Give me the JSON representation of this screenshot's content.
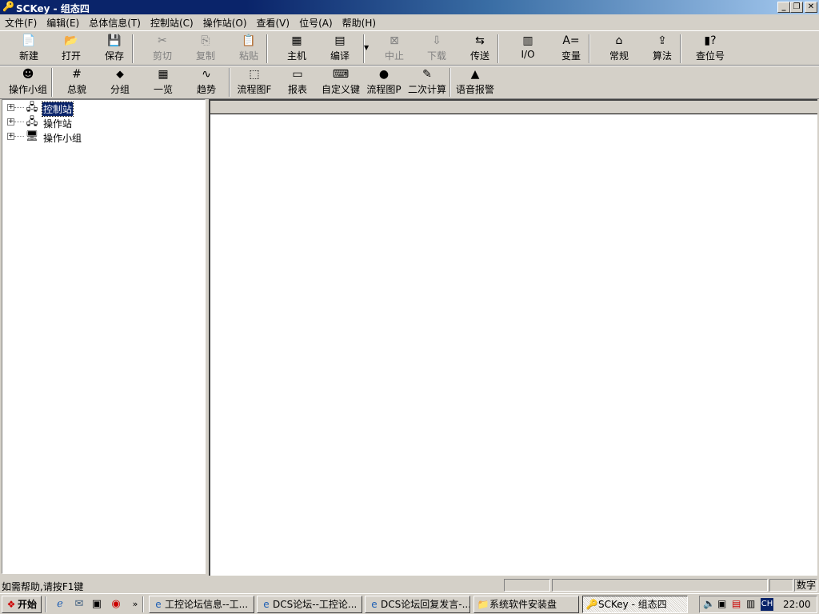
{
  "window": {
    "title": "SCKey - 组态四",
    "min": "_",
    "restore": "❐",
    "close": "✕"
  },
  "menu": [
    "文件(F)",
    "编辑(E)",
    "总体信息(T)",
    "控制站(C)",
    "操作站(O)",
    "查看(V)",
    "位号(A)",
    "帮助(H)"
  ],
  "toolbar1": [
    {
      "label": "新建",
      "icon": "📄",
      "disabled": false
    },
    {
      "label": "打开",
      "icon": "📂",
      "disabled": false
    },
    {
      "label": "保存",
      "icon": "💾",
      "disabled": false
    },
    {
      "label": "剪切",
      "icon": "✂",
      "disabled": true
    },
    {
      "label": "复制",
      "icon": "⎘",
      "disabled": true
    },
    {
      "label": "粘贴",
      "icon": "📋",
      "disabled": true
    },
    {
      "label": "主机",
      "icon": "▦",
      "disabled": false
    },
    {
      "label": "编译",
      "icon": "▤",
      "disabled": false
    },
    {
      "label": "中止",
      "icon": "⊠",
      "disabled": true
    },
    {
      "label": "下载",
      "icon": "⇩",
      "disabled": true
    },
    {
      "label": "传送",
      "icon": "⇆",
      "disabled": false
    },
    {
      "label": "I/O",
      "icon": "▥",
      "disabled": false
    },
    {
      "label": "变量",
      "icon": "A=",
      "disabled": false
    },
    {
      "label": "常规",
      "icon": "⌂",
      "disabled": false
    },
    {
      "label": "算法",
      "icon": "⇪",
      "disabled": false
    },
    {
      "label": "查位号",
      "icon": "▮?",
      "disabled": false
    }
  ],
  "toolbar2": [
    {
      "label": "操作小组",
      "icon": "☻"
    },
    {
      "label": "总貌",
      "icon": "#"
    },
    {
      "label": "分组",
      "icon": "⬥"
    },
    {
      "label": "一览",
      "icon": "▦"
    },
    {
      "label": "趋势",
      "icon": "∿"
    },
    {
      "label": "流程图F",
      "icon": "⬚"
    },
    {
      "label": "报表",
      "icon": "▭"
    },
    {
      "label": "自定义键",
      "icon": "⌨"
    },
    {
      "label": "流程图P",
      "icon": "●"
    },
    {
      "label": "二次计算",
      "icon": "✎"
    },
    {
      "label": "语音报警",
      "icon": "▲"
    }
  ],
  "tree": [
    {
      "label": "控制站",
      "icon": "🖧",
      "selected": true
    },
    {
      "label": "操作站",
      "icon": "🖧",
      "selected": false
    },
    {
      "label": "操作小组",
      "icon": "🖥",
      "selected": false
    }
  ],
  "status": {
    "help": "如需帮助,请按F1键",
    "numlock": "数字"
  },
  "taskbar": {
    "start": "开始",
    "tasks": [
      {
        "label": "工控论坛信息--工...",
        "icon": "e",
        "active": false
      },
      {
        "label": "DCS论坛--工控论...",
        "icon": "e",
        "active": false
      },
      {
        "label": "DCS论坛回复发言-...",
        "icon": "e",
        "active": false
      },
      {
        "label": "系统软件安装盘",
        "icon": "📁",
        "active": false
      },
      {
        "label": "SCKey - 组态四",
        "icon": "🔑",
        "active": true
      }
    ],
    "clock": "22:00",
    "lang": "CH"
  }
}
